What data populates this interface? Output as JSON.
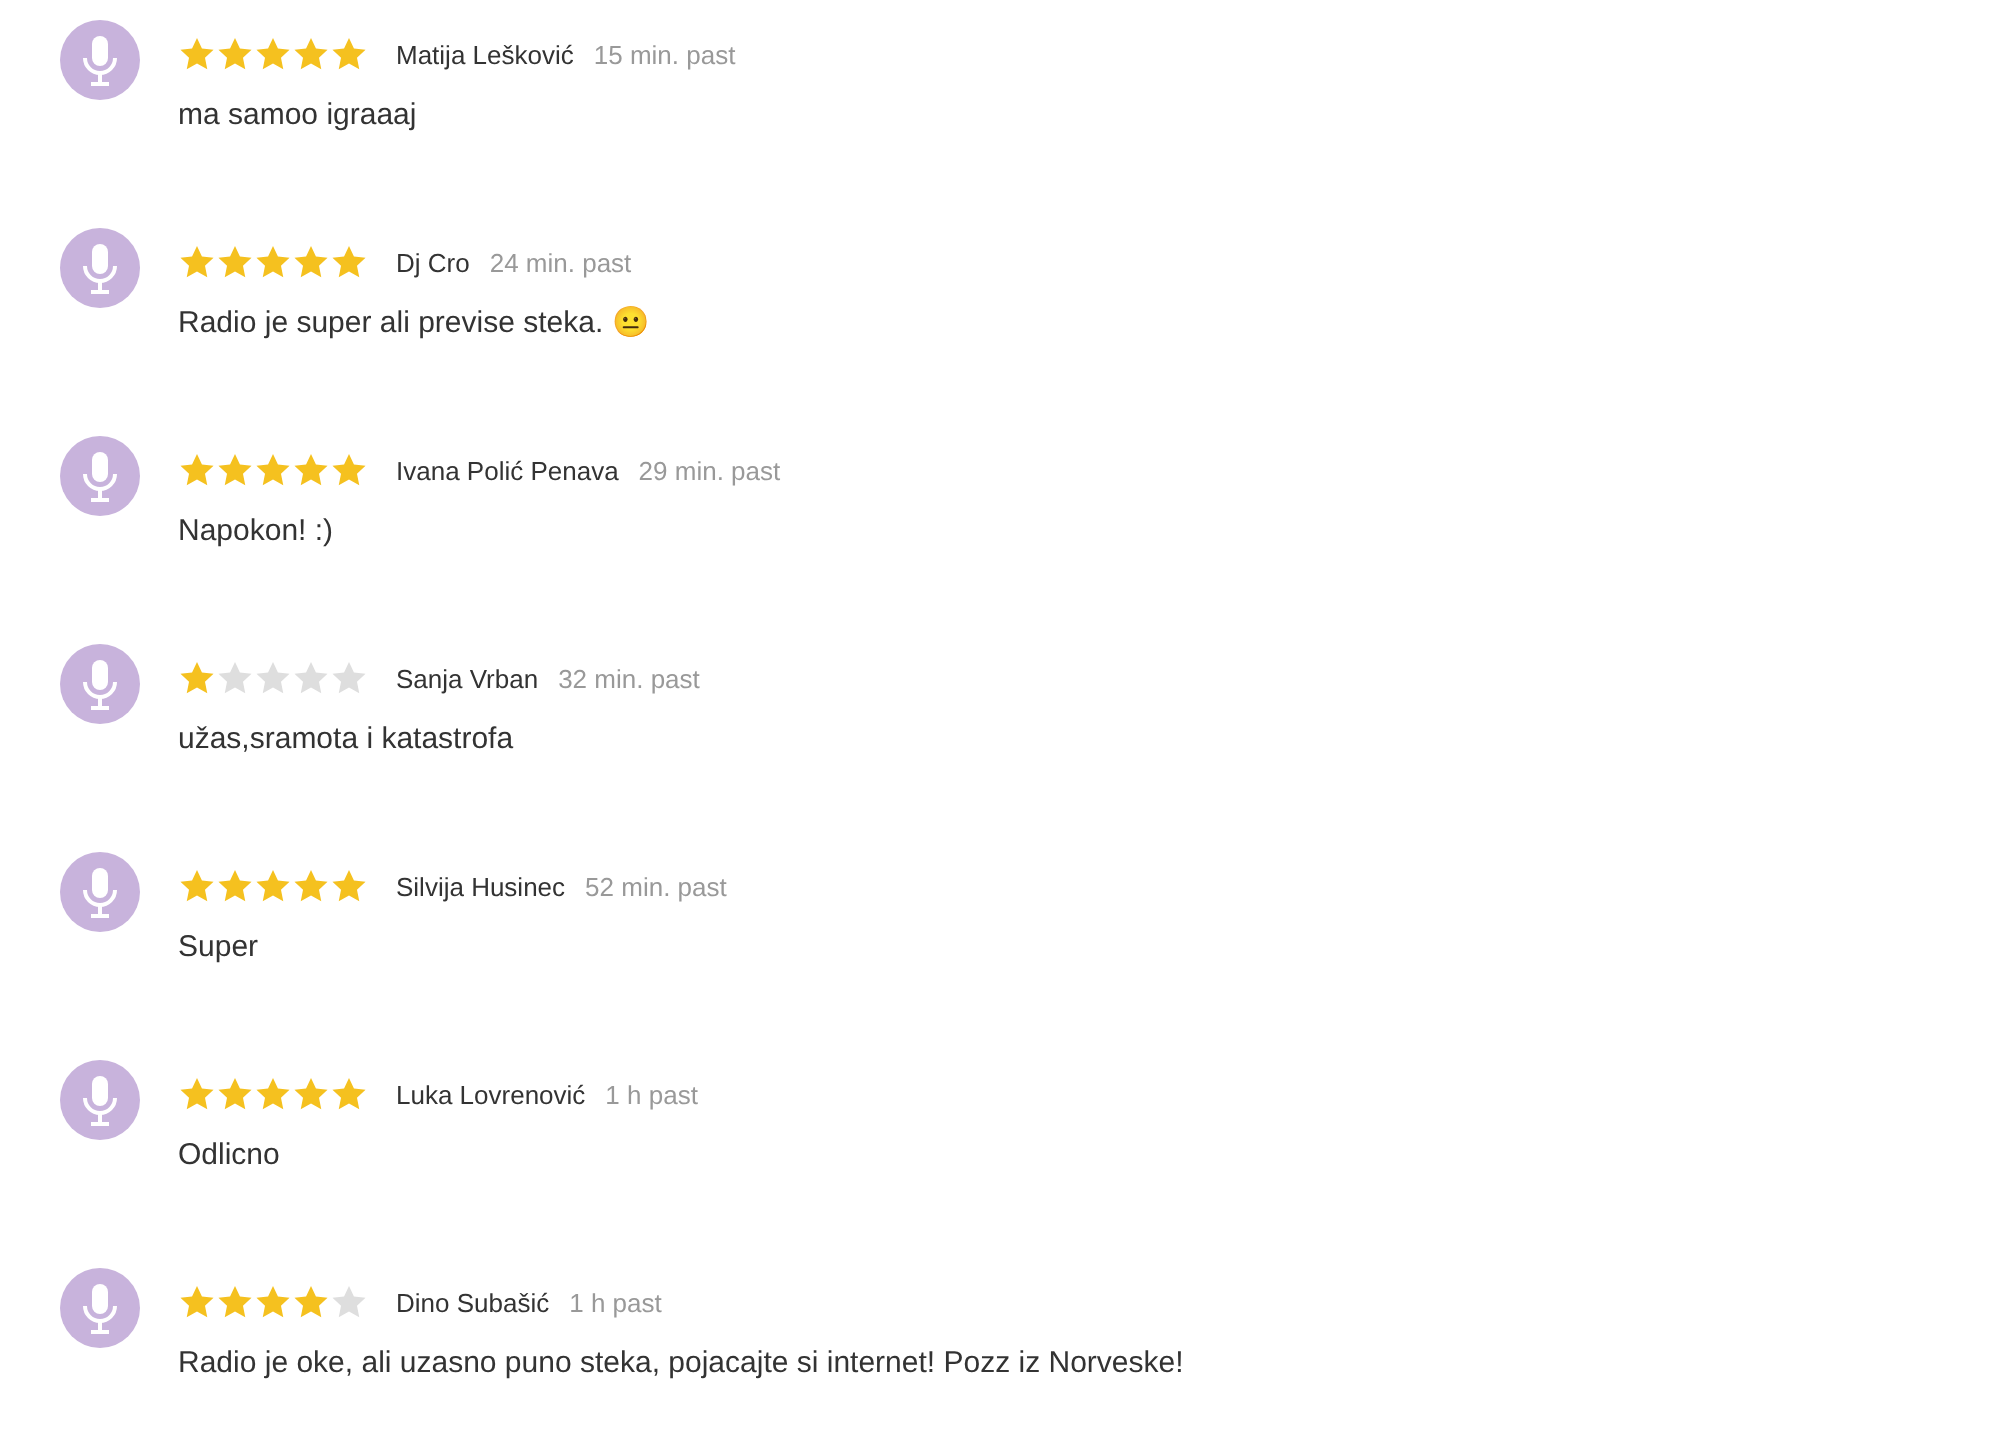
{
  "reviews": [
    {
      "stars": 5,
      "author": "Matija Lešković",
      "time": "15 min. past",
      "comment": "ma samoo igraaaj"
    },
    {
      "stars": 5,
      "author": "Dj Cro",
      "time": "24 min. past",
      "comment": "Radio je super ali previse steka. 😐"
    },
    {
      "stars": 5,
      "author": "Ivana Polić Penava",
      "time": "29 min. past",
      "comment": "Napokon! :)"
    },
    {
      "stars": 1,
      "author": "Sanja Vrban",
      "time": "32 min. past",
      "comment": "užas,sramota i katastrofa"
    },
    {
      "stars": 5,
      "author": "Silvija Husinec",
      "time": "52 min. past",
      "comment": "Super"
    },
    {
      "stars": 5,
      "author": "Luka Lovrenović",
      "time": "1 h past",
      "comment": "Odlicno"
    },
    {
      "stars": 4,
      "author": "Dino Subašić",
      "time": "1 h past",
      "comment": "Radio je oke, ali uzasno puno steka, pojacajte si internet! Pozz iz Norveske!"
    }
  ]
}
